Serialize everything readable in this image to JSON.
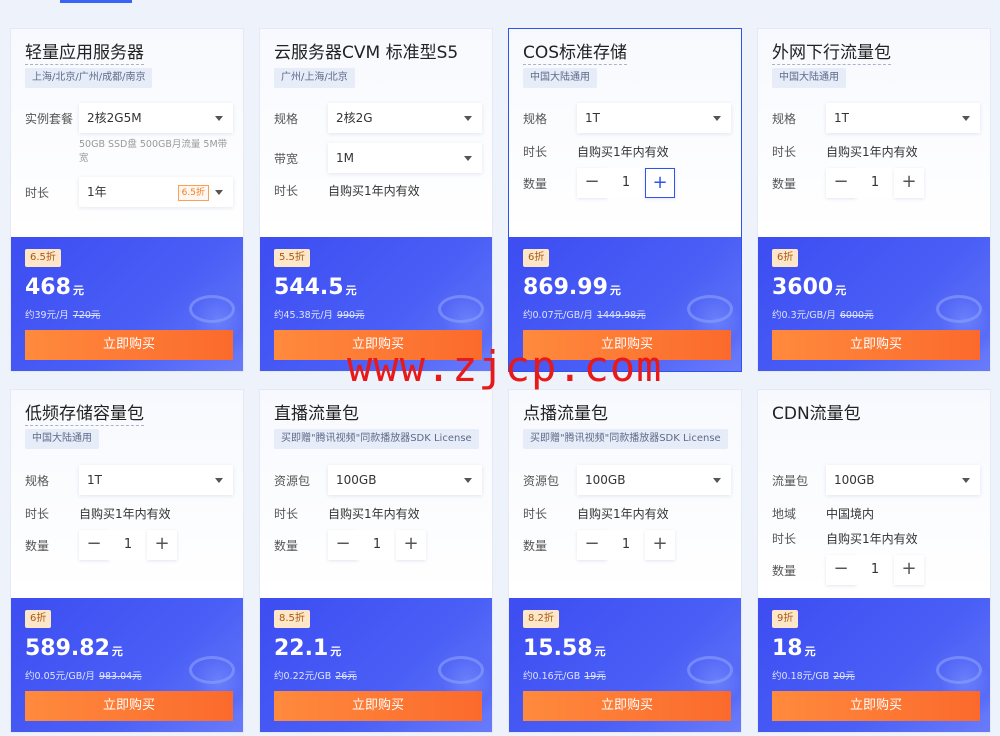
{
  "watermark": "www.zjcp.com",
  "cards": [
    {
      "title": "轻量应用服务器",
      "region": "上海/北京/广州/成都/南京",
      "rows": {
        "spec_label": "实例套餐",
        "spec_value": "2核2G5M",
        "note": "50GB SSD盘 500GB月流量 5M带宽",
        "dur_label": "时长",
        "dur_value": "1年",
        "dur_badge": "6.5折"
      },
      "discount": "6.5折",
      "price": "468",
      "unit": "元",
      "sub": "约39元/月",
      "orig": "720元",
      "buy": "立即购买"
    },
    {
      "title": "云服务器CVM 标准型S5",
      "region": "广州/上海/北京",
      "rows": {
        "spec_label": "规格",
        "spec_value": "2核2G",
        "bw_label": "带宽",
        "bw_value": "1M",
        "dur_label": "时长",
        "dur_text": "自购买1年内有效"
      },
      "discount": "5.5折",
      "price": "544.5",
      "unit": "元",
      "sub": "约45.38元/月",
      "orig": "990元",
      "buy": "立即购买"
    },
    {
      "title": "COS标准存储",
      "region": "中国大陆通用",
      "rows": {
        "spec_label": "规格",
        "spec_value": "1T",
        "dur_label": "时长",
        "dur_text": "自购买1年内有效",
        "qty_label": "数量",
        "qty_value": "1"
      },
      "discount": "6折",
      "price": "869.99",
      "unit": "元",
      "sub": "约0.07元/GB/月",
      "orig": "1449.98元",
      "buy": "立即购买"
    },
    {
      "title": "外网下行流量包",
      "region": "中国大陆通用",
      "rows": {
        "spec_label": "规格",
        "spec_value": "1T",
        "dur_label": "时长",
        "dur_text": "自购买1年内有效",
        "qty_label": "数量",
        "qty_value": "1"
      },
      "discount": "6折",
      "price": "3600",
      "unit": "元",
      "sub": "约0.3元/GB/月",
      "orig": "6000元",
      "buy": "立即购买"
    },
    {
      "title": "低频存储容量包",
      "region": "中国大陆通用",
      "rows": {
        "spec_label": "规格",
        "spec_value": "1T",
        "dur_label": "时长",
        "dur_text": "自购买1年内有效",
        "qty_label": "数量",
        "qty_value": "1"
      },
      "discount": "6折",
      "price": "589.82",
      "unit": "元",
      "sub": "约0.05元/GB/月",
      "orig": "983.04元",
      "buy": "立即购买"
    },
    {
      "title": "直播流量包",
      "region": "买即赠\"腾讯视频\"同款播放器SDK License",
      "rows": {
        "spec_label": "资源包",
        "spec_value": "100GB",
        "dur_label": "时长",
        "dur_text": "自购买1年内有效",
        "qty_label": "数量",
        "qty_value": "1"
      },
      "discount": "8.5折",
      "price": "22.1",
      "unit": "元",
      "sub": "约0.22元/GB",
      "orig": "26元",
      "buy": "立即购买"
    },
    {
      "title": "点播流量包",
      "region": "买即赠\"腾讯视频\"同款播放器SDK License",
      "rows": {
        "spec_label": "资源包",
        "spec_value": "100GB",
        "dur_label": "时长",
        "dur_text": "自购买1年内有效",
        "qty_label": "数量",
        "qty_value": "1"
      },
      "discount": "8.2折",
      "price": "15.58",
      "unit": "元",
      "sub": "约0.16元/GB",
      "orig": "19元",
      "buy": "立即购买"
    },
    {
      "title": "CDN流量包",
      "rows": {
        "spec_label": "流量包",
        "spec_value": "100GB",
        "area_label": "地域",
        "area_text": "中国境内",
        "dur_label": "时长",
        "dur_text": "自购买1年内有效",
        "qty_label": "数量",
        "qty_value": "1"
      },
      "discount": "9折",
      "price": "18",
      "unit": "元",
      "sub": "约0.18元/GB",
      "orig": "20元",
      "buy": "立即购买"
    }
  ]
}
